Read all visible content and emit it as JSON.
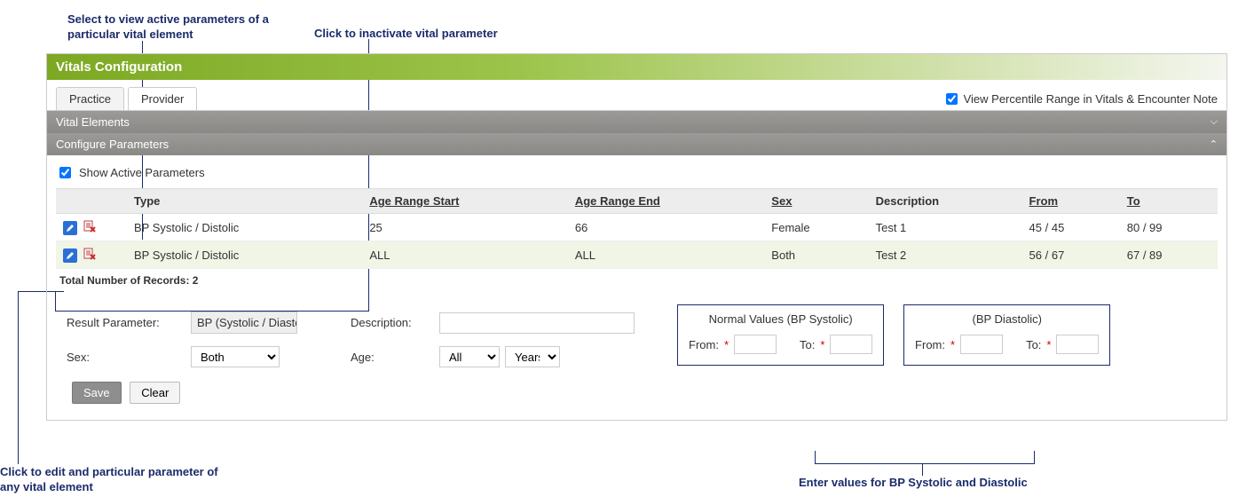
{
  "callouts": {
    "c1": "Select to view active parameters of a particular vital element",
    "c2": "Click to inactivate vital parameter",
    "c3": "Click to edit and particular parameter of any vital element",
    "c4": "Enter values for BP Systolic and Diastolic"
  },
  "header": {
    "title": "Vitals Configuration"
  },
  "tabs": {
    "practice": "Practice",
    "provider": "Provider"
  },
  "viewRange": {
    "label": "View Percentile Range in Vitals & Encounter Note"
  },
  "panels": {
    "vitalElements": "Vital Elements",
    "configure": "Configure Parameters"
  },
  "showActive": "Show Active Parameters",
  "columns": {
    "type": "Type",
    "ageStart": "Age Range Start",
    "ageEnd": "Age Range End",
    "sex": "Sex",
    "desc": "Description",
    "from": "From",
    "to": "To"
  },
  "rows": [
    {
      "type": "BP Systolic / Distolic",
      "ageStart": "25",
      "ageEnd": "66",
      "sex": "Female",
      "desc": "Test 1",
      "from": "45 / 45",
      "to": "80 / 99"
    },
    {
      "type": "BP Systolic / Distolic",
      "ageStart": "ALL",
      "ageEnd": "ALL",
      "sex": "Both",
      "desc": "Test 2",
      "from": "56 / 67",
      "to": "67 / 89"
    }
  ],
  "totalRecords": "Total Number of Records: 2",
  "form": {
    "resultParamLabel": "Result Parameter:",
    "resultParamValue": "BP (Systolic / Diastolic)",
    "descLabel": "Description:",
    "sexLabel": "Sex:",
    "sexValue": "Both",
    "ageLabel": "Age:",
    "ageValue": "All",
    "ageUnit": "Years",
    "save": "Save",
    "clear": "Clear"
  },
  "nv": {
    "sysTitle": "Normal Values (BP Systolic)",
    "diaTitle": "(BP Diastolic)",
    "fromLabel": "From:",
    "toLabel": "To:",
    "star": "*"
  }
}
